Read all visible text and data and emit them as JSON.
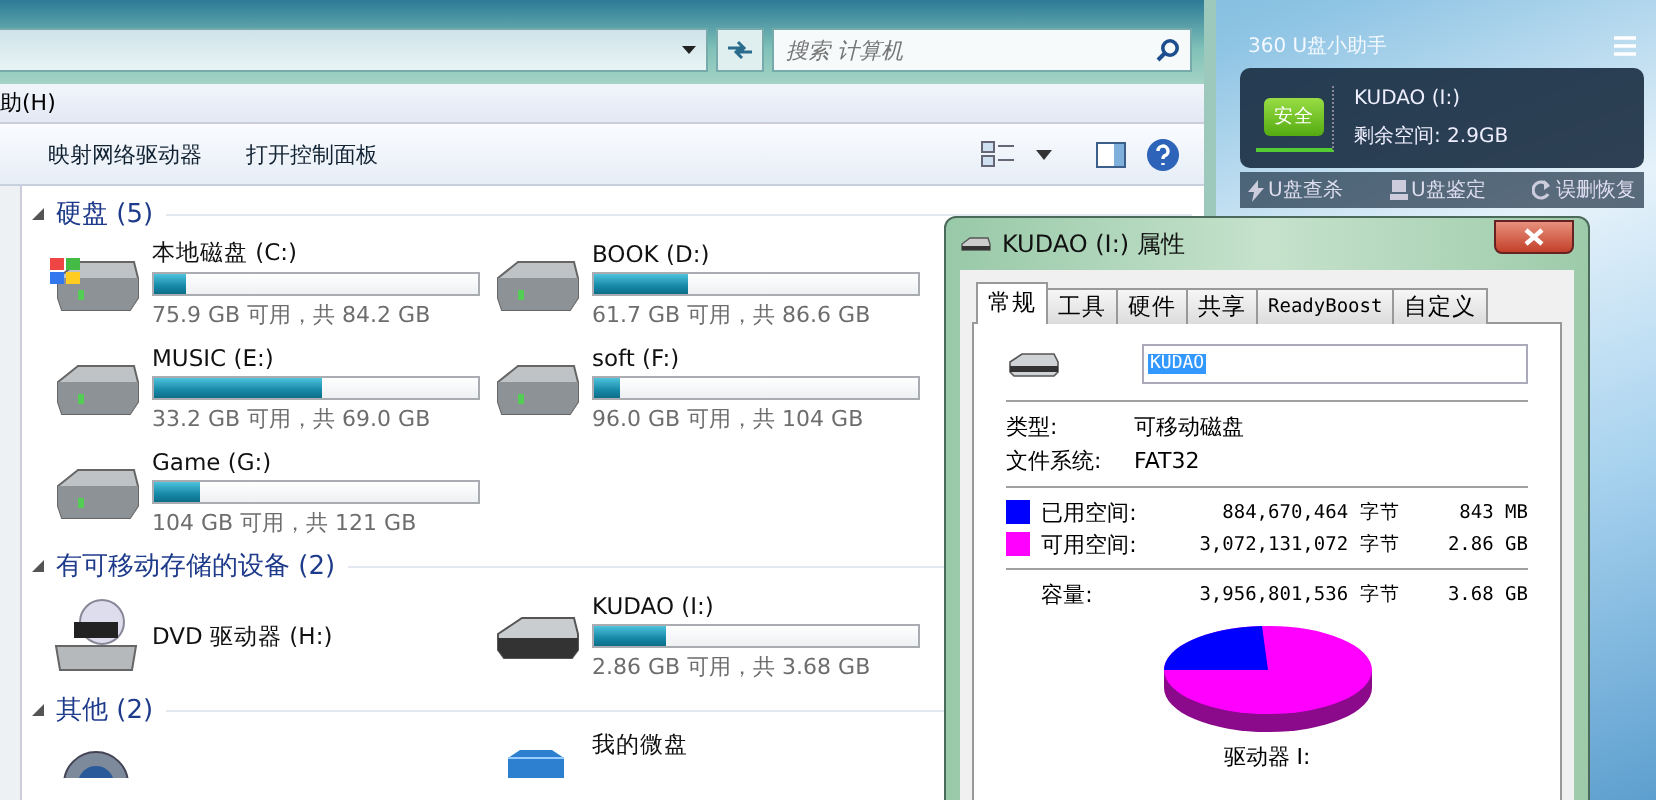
{
  "explorer": {
    "search": {
      "placeholder": "搜索 计算机"
    },
    "menu": [
      "助(H)"
    ],
    "toolbar": [
      "映射网络驱动器",
      "打开控制面板"
    ],
    "groups": [
      {
        "title": "硬盘 (5)",
        "expanded": true,
        "items": [
          {
            "kind": "system-drive",
            "name": "本地磁盘 (C:)",
            "level": 0.1,
            "info": "75.9 GB 可用，共 84.2 GB"
          },
          {
            "kind": "hdd",
            "name": "BOOK (D:)",
            "level": 0.29,
            "info": "61.7 GB 可用，共 86.6 GB"
          },
          {
            "kind": "hdd",
            "name": "MUSIC (E:)",
            "level": 0.52,
            "info": "33.2 GB 可用，共 69.0 GB"
          },
          {
            "kind": "hdd",
            "name": "soft (F:)",
            "level": 0.08,
            "info": "96.0 GB 可用，共 104 GB"
          },
          {
            "kind": "hdd",
            "name": "Game (G:)",
            "level": 0.14,
            "info": "104 GB 可用，共 121 GB"
          }
        ]
      },
      {
        "title": "有可移动存储的设备 (2)",
        "expanded": true,
        "items": [
          {
            "kind": "dvd",
            "name": "DVD 驱动器 (H:)"
          },
          {
            "kind": "usb",
            "name": "KUDAO (I:)",
            "level": 0.22,
            "info": "2.86 GB 可用，共 3.68 GB"
          }
        ]
      },
      {
        "title": "其他 (2)",
        "expanded": true,
        "items": [
          {
            "kind": "webcam"
          },
          {
            "kind": "cloud",
            "name": "我的微盘"
          }
        ]
      }
    ]
  },
  "dialog": {
    "title": "KUDAO (I:) 属性",
    "tabs": [
      {
        "label": "常规",
        "selected": true
      },
      {
        "label": "工具",
        "selected": false
      },
      {
        "label": "硬件",
        "selected": false
      },
      {
        "label": "共享",
        "selected": false
      },
      {
        "label": "ReadyBoost",
        "selected": false
      },
      {
        "label": "自定义",
        "selected": false
      }
    ],
    "name_value": "KUDAO",
    "properties": [
      {
        "label": "类型:",
        "value": "可移动磁盘"
      },
      {
        "label": "文件系统:",
        "value": "FAT32"
      }
    ],
    "space": [
      {
        "label": "已用空间:",
        "bytes": "884,670,464 字节",
        "size": "843 MB",
        "color": "#0000ff"
      },
      {
        "label": "可用空间:",
        "bytes": "3,072,131,072 字节",
        "size": "2.86 GB",
        "color": "#ff00ff"
      }
    ],
    "capacity": {
      "label": "容量:",
      "bytes": "3,956,801,536 字节",
      "size": "3.68 GB"
    },
    "drive_label": "驱动器 I:"
  },
  "widget": {
    "title": "360 U盘小助手",
    "badge": "安全",
    "drive": "KUDAO (I:)",
    "free": "剩余空间: 2.9GB",
    "actions": [
      "U盘查杀",
      "U盘鉴定",
      "误删恢复"
    ]
  }
}
